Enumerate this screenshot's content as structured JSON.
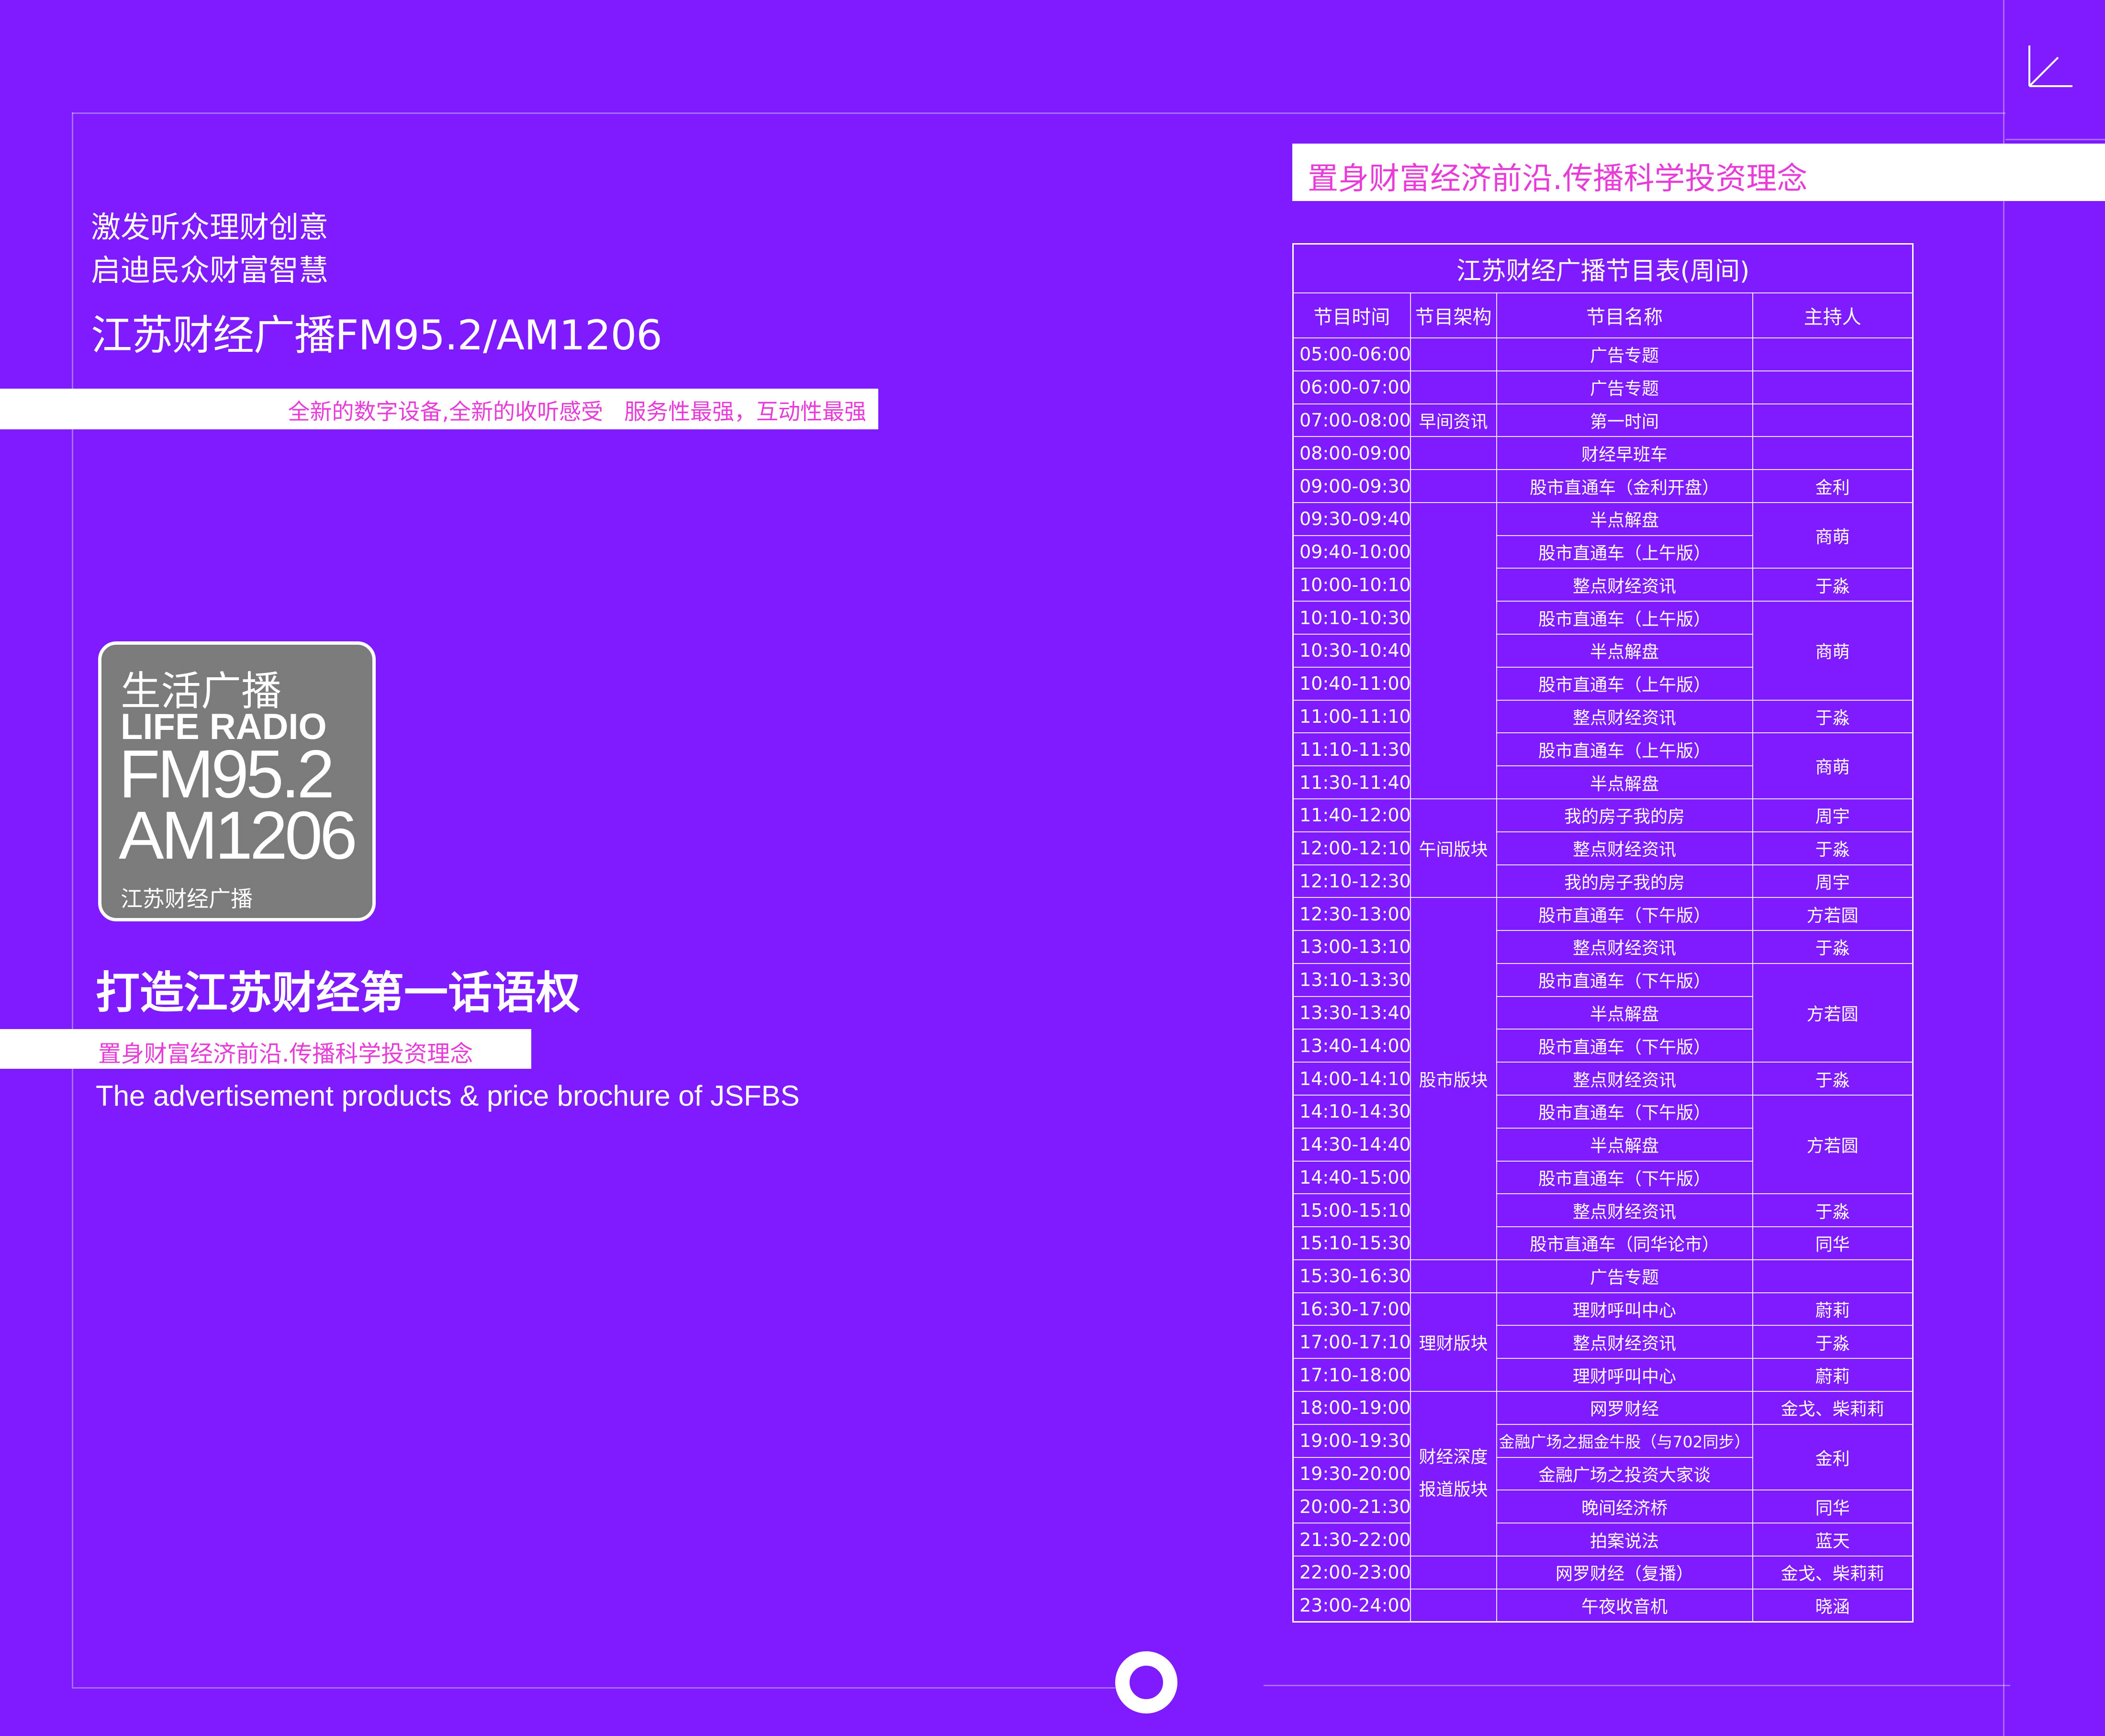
{
  "left": {
    "tagline_1": "激发听众理财创意",
    "tagline_2": "启迪民众财富智慧",
    "station_title": "江苏财经广播FM95.2/AM1206",
    "band_text": "全新的数字设备,全新的收听感受   服务性最强，互动性最强",
    "badge": {
      "cn_name": "生活广播",
      "en_name": "LIFE RADIO",
      "fm": "FM95.2",
      "am": "AM1206",
      "station": "江苏财经广播"
    },
    "slogan": "打造江苏财经第一话语权",
    "band2_text": "置身财富经济前沿.传播科学投资理念",
    "english_line": "The advertisement products & price brochure of JSFBS"
  },
  "right": {
    "band_text": "置身财富经济前沿.传播科学投资理念"
  },
  "schedule": {
    "title": "江苏财经广播节目表(周间)",
    "headers": [
      "节目时间",
      "节目架构",
      "节目名称",
      "主持人"
    ],
    "rows": [
      {
        "time": "05:00-06:00",
        "program": "广告专题"
      },
      {
        "time": "06:00-07:00",
        "program": "广告专题"
      },
      {
        "time": "07:00-08:00",
        "program": "第一时间"
      },
      {
        "time": "08:00-09:00",
        "program": "财经早班车"
      },
      {
        "time": "09:00-09:30",
        "program": "股市直通车（金利开盘）"
      },
      {
        "time": "09:30-09:40",
        "program": "半点解盘"
      },
      {
        "time": "09:40-10:00",
        "program": "股市直通车（上午版）"
      },
      {
        "time": "10:00-10:10",
        "program": "整点财经资讯"
      },
      {
        "time": "10:10-10:30",
        "program": "股市直通车（上午版）"
      },
      {
        "time": "10:30-10:40",
        "program": "半点解盘"
      },
      {
        "time": "10:40-11:00",
        "program": "股市直通车（上午版）"
      },
      {
        "time": "11:00-11:10",
        "program": "整点财经资讯"
      },
      {
        "time": "11:10-11:30",
        "program": "股市直通车（上午版）"
      },
      {
        "time": "11:30-11:40",
        "program": "半点解盘"
      },
      {
        "time": "11:40-12:00",
        "program": "我的房子我的房"
      },
      {
        "time": "12:00-12:10",
        "program": "整点财经资讯"
      },
      {
        "time": "12:10-12:30",
        "program": "我的房子我的房"
      },
      {
        "time": "12:30-13:00",
        "program": "股市直通车（下午版）"
      },
      {
        "time": "13:00-13:10",
        "program": "整点财经资讯"
      },
      {
        "time": "13:10-13:30",
        "program": "股市直通车（下午版）"
      },
      {
        "time": "13:30-13:40",
        "program": "半点解盘"
      },
      {
        "time": "13:40-14:00",
        "program": "股市直通车（下午版）"
      },
      {
        "time": "14:00-14:10",
        "program": "整点财经资讯"
      },
      {
        "time": "14:10-14:30",
        "program": "股市直通车（下午版）"
      },
      {
        "time": "14:30-14:40",
        "program": "半点解盘"
      },
      {
        "time": "14:40-15:00",
        "program": "股市直通车（下午版）"
      },
      {
        "time": "15:00-15:10",
        "program": "整点财经资讯"
      },
      {
        "time": "15:10-15:30",
        "program": "股市直通车（同华论市）"
      },
      {
        "time": "15:30-16:30",
        "program": "广告专题"
      },
      {
        "time": "16:30-17:00",
        "program": "理财呼叫中心"
      },
      {
        "time": "17:00-17:10",
        "program": "整点财经资讯"
      },
      {
        "time": "17:10-18:00",
        "program": "理财呼叫中心"
      },
      {
        "time": "18:00-19:00",
        "program": "网罗财经"
      },
      {
        "time": "19:00-19:30",
        "program": "金融广场之掘金牛股（与702同步）"
      },
      {
        "time": "19:30-20:00",
        "program": "金融广场之投资大家谈"
      },
      {
        "time": "20:00-21:30",
        "program": "晚间经济桥"
      },
      {
        "time": "21:30-22:00",
        "program": "拍案说法"
      },
      {
        "time": "22:00-23:00",
        "program": "网罗财经（复播）"
      },
      {
        "time": "23:00-24:00",
        "program": "午夜收音机"
      }
    ],
    "segments": [
      {
        "label": "早间资讯"
      },
      {
        "label": "午间版块"
      },
      {
        "label": "股市版块"
      },
      {
        "label": "理财版块"
      },
      {
        "label": "财经深度报道版块"
      }
    ],
    "hosts": [
      {
        "name": "金利"
      },
      {
        "name": "商萌"
      },
      {
        "name": "于淼"
      },
      {
        "name": "商萌"
      },
      {
        "name": "于淼"
      },
      {
        "name": "商萌"
      },
      {
        "name": "周宇"
      },
      {
        "name": "于淼"
      },
      {
        "name": "周宇"
      },
      {
        "name": "方若圆"
      },
      {
        "name": "于淼"
      },
      {
        "name": "方若圆"
      },
      {
        "name": "于淼"
      },
      {
        "name": "方若圆"
      },
      {
        "name": "于淼"
      },
      {
        "name": "同华"
      },
      {
        "name": "蔚莉"
      },
      {
        "name": "于淼"
      },
      {
        "name": "蔚莉"
      },
      {
        "name": "金戈、柴莉莉"
      },
      {
        "name": "金利"
      },
      {
        "name": "同华"
      },
      {
        "name": "蓝天"
      },
      {
        "name": "金戈、柴莉莉"
      },
      {
        "name": "晓涵"
      }
    ]
  },
  "colors": {
    "background": "#7f1cff",
    "band_text": "#e83cd9",
    "badge_fill": "#7b7b7b"
  },
  "icons": [
    "corner-arrow-icon",
    "ring-icon"
  ]
}
